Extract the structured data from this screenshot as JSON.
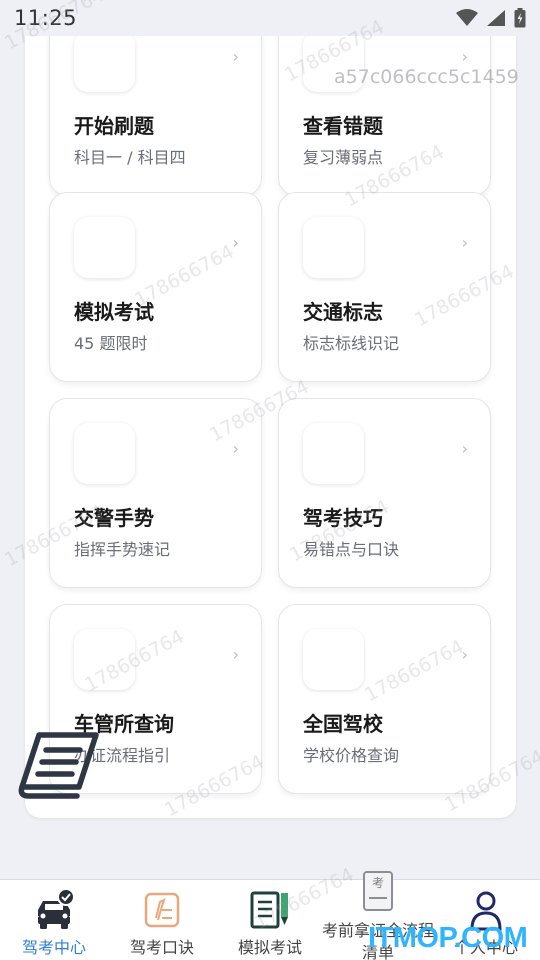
{
  "status_bar": {
    "time": "11:25"
  },
  "watermark": {
    "user_id": "178666764",
    "device_code": "a57c066ccc5c1459"
  },
  "tiles": [
    {
      "title": "开始刷题",
      "subtitle": "科目一 / 科目四"
    },
    {
      "title": "查看错题",
      "subtitle": "复习薄弱点"
    },
    {
      "title": "模拟考试",
      "subtitle": "45 题限时"
    },
    {
      "title": "交通标志",
      "subtitle": "标志标线识记"
    },
    {
      "title": "交警手势",
      "subtitle": "指挥手势速记"
    },
    {
      "title": "驾考技巧",
      "subtitle": "易错点与口诀"
    },
    {
      "title": "车管所查询",
      "subtitle": "办证流程指引"
    },
    {
      "title": "全国驾校",
      "subtitle": "学校价格查询"
    }
  ],
  "chevron": "›",
  "tab_bar": {
    "tabs": [
      {
        "label": "驾考中心",
        "icon": "car-check-icon",
        "active": true
      },
      {
        "label": "驾考口诀",
        "icon": "notepad-pencil-icon",
        "active": false
      },
      {
        "label": "模拟考试",
        "icon": "notebook-pencil-icon",
        "active": false
      },
      {
        "label": "考前拿证全流程清单",
        "icon": "exam-book-icon",
        "active": false
      },
      {
        "label": "个人中心",
        "icon": "person-icon",
        "active": false
      }
    ],
    "exam_icon_text": "考"
  },
  "site_badge": "ITMOP.COM",
  "colors": {
    "active_tab": "#2f7fd8",
    "badge": "#2fb5ff",
    "background": "#eef0f6"
  }
}
